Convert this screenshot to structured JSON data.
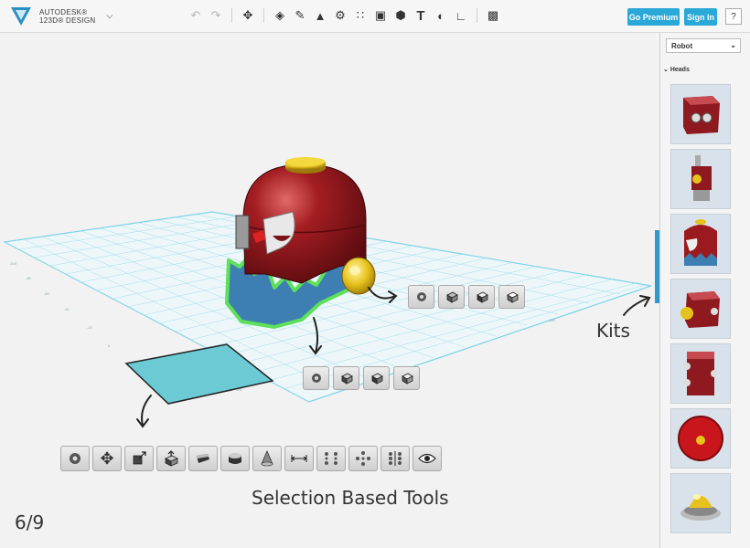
{
  "app": {
    "brand_line1": "AUTODESK®",
    "brand_line2": "123D® DESIGN",
    "go_premium": "Go Premium",
    "sign_in": "Sign In",
    "help": "?"
  },
  "toolbar": {
    "icons": [
      "undo-icon",
      "redo-icon",
      "transform-icon",
      "primitives-icon",
      "sketch-icon",
      "construct-icon",
      "modify-icon",
      "pattern-icon",
      "grouping-icon",
      "combine-icon",
      "text-icon",
      "snap-icon",
      "measure-icon",
      "material-icon"
    ]
  },
  "sidebar": {
    "kit_select": "Robot",
    "category": "Heads"
  },
  "annotations": {
    "kits_label": "Kits",
    "selection_label": "Selection Based Tools",
    "page_counter": "6/9"
  },
  "colors": {
    "accent": "#2aa8d8",
    "grid": "#7fd3e6",
    "robot_red": "#9b1a1f",
    "robot_blue": "#3d7fb3",
    "selection_green": "#5de05a",
    "plane_cyan": "#6bcad4"
  }
}
